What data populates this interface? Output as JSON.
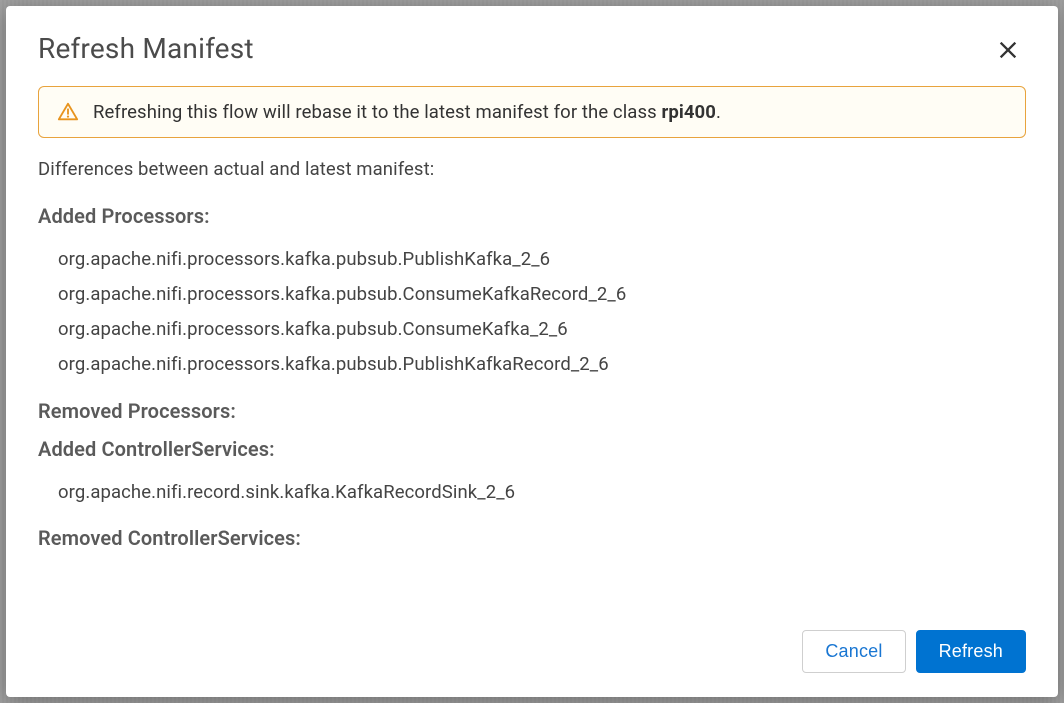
{
  "modal": {
    "title": "Refresh Manifest",
    "alert": {
      "prefix": "Refreshing this flow will rebase it to the latest manifest for the class ",
      "class_name": "rpi400",
      "suffix": "."
    },
    "intro": "Differences between actual and latest manifest:",
    "sections": {
      "added_processors": {
        "heading": "Added Processors:",
        "items": [
          "org.apache.nifi.processors.kafka.pubsub.PublishKafka_2_6",
          "org.apache.nifi.processors.kafka.pubsub.ConsumeKafkaRecord_2_6",
          "org.apache.nifi.processors.kafka.pubsub.ConsumeKafka_2_6",
          "org.apache.nifi.processors.kafka.pubsub.PublishKafkaRecord_2_6"
        ]
      },
      "removed_processors": {
        "heading": "Removed Processors:",
        "items": []
      },
      "added_controller_services": {
        "heading": "Added ControllerServices:",
        "items": [
          "org.apache.nifi.record.sink.kafka.KafkaRecordSink_2_6"
        ]
      },
      "removed_controller_services": {
        "heading": "Removed ControllerServices:",
        "items": []
      }
    },
    "buttons": {
      "cancel": "Cancel",
      "refresh": "Refresh"
    }
  }
}
